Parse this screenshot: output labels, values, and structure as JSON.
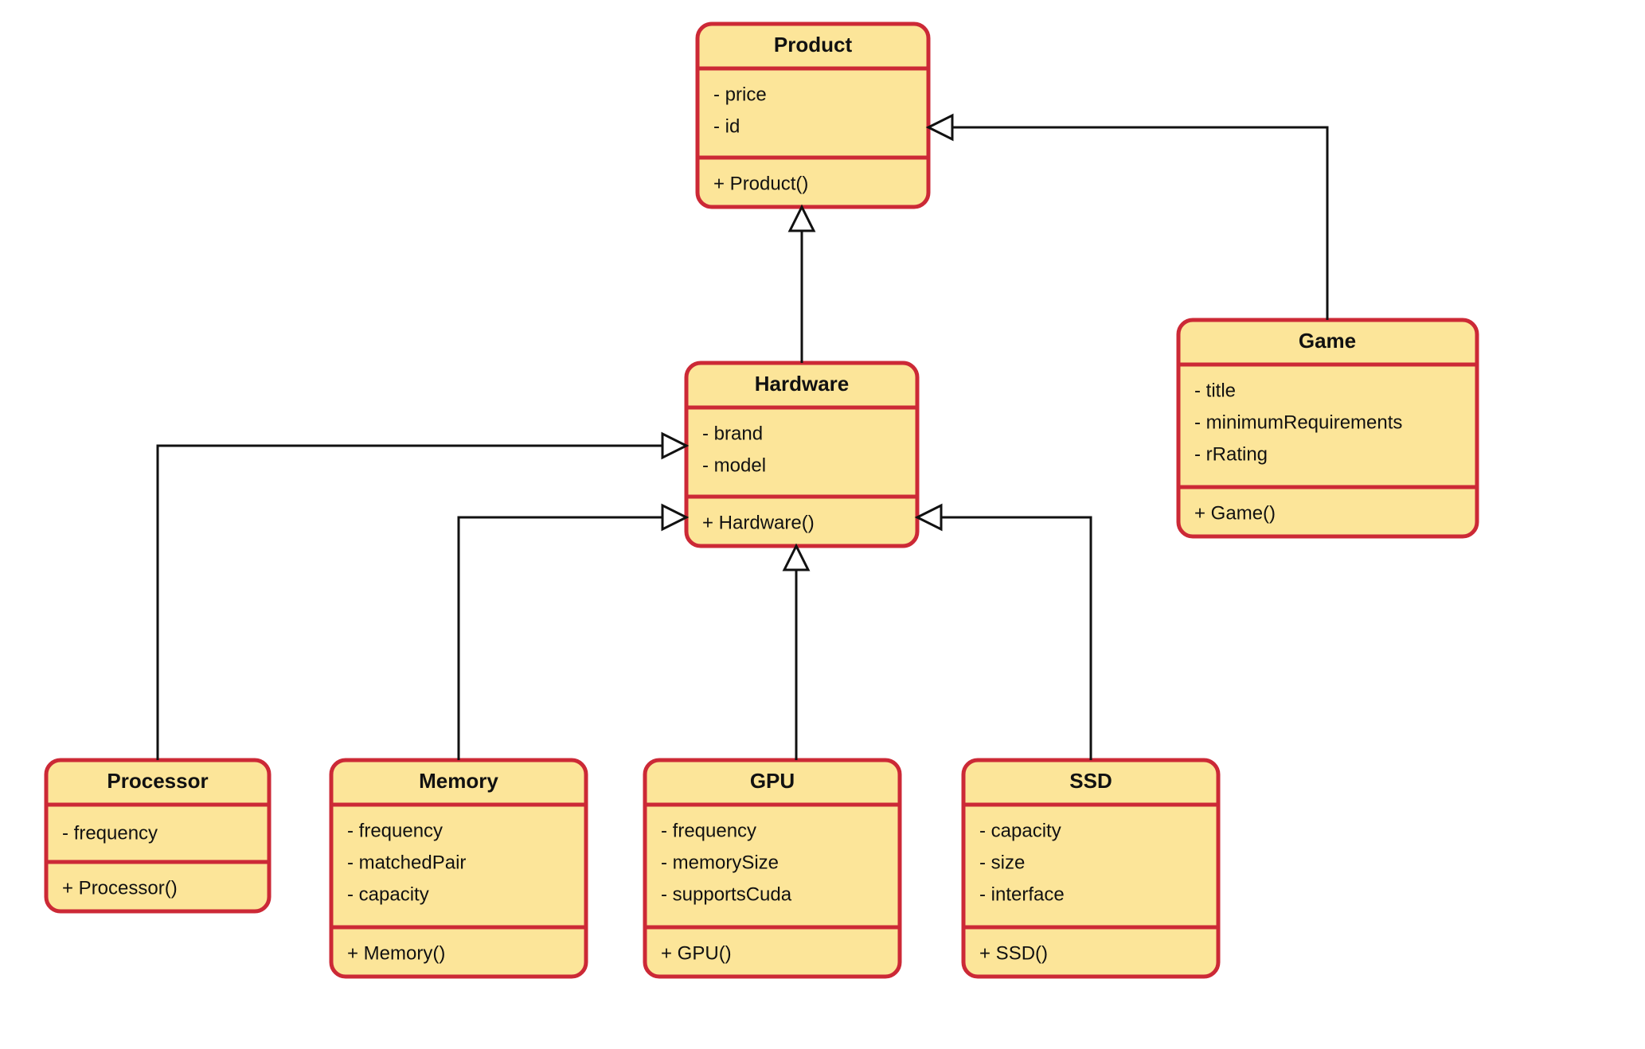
{
  "diagram": {
    "type": "uml_class_diagram",
    "classes": {
      "product": {
        "name": "Product",
        "attrs": [
          "- price",
          "- id"
        ],
        "ops": [
          "+ Product()"
        ]
      },
      "hardware": {
        "name": "Hardware",
        "attrs": [
          "- brand",
          "- model"
        ],
        "ops": [
          "+ Hardware()"
        ]
      },
      "game": {
        "name": "Game",
        "attrs": [
          "- title",
          "- minimumRequirements",
          "- rRating"
        ],
        "ops": [
          "+ Game()"
        ]
      },
      "processor": {
        "name": "Processor",
        "attrs": [
          "- frequency"
        ],
        "ops": [
          "+ Processor()"
        ]
      },
      "memory": {
        "name": "Memory",
        "attrs": [
          "- frequency",
          "- matchedPair",
          "- capacity"
        ],
        "ops": [
          "+ Memory()"
        ]
      },
      "gpu": {
        "name": "GPU",
        "attrs": [
          "- frequency",
          "- memorySize",
          "- supportsCuda"
        ],
        "ops": [
          "+ GPU()"
        ]
      },
      "ssd": {
        "name": "SSD",
        "attrs": [
          "- capacity",
          "- size",
          "- interface"
        ],
        "ops": [
          "+ SSD()"
        ]
      }
    },
    "relations": [
      {
        "from": "hardware",
        "to": "product",
        "kind": "generalization"
      },
      {
        "from": "game",
        "to": "product",
        "kind": "generalization"
      },
      {
        "from": "processor",
        "to": "hardware",
        "kind": "generalization"
      },
      {
        "from": "memory",
        "to": "hardware",
        "kind": "generalization"
      },
      {
        "from": "gpu",
        "to": "hardware",
        "kind": "generalization"
      },
      {
        "from": "ssd",
        "to": "hardware",
        "kind": "generalization"
      }
    ]
  }
}
